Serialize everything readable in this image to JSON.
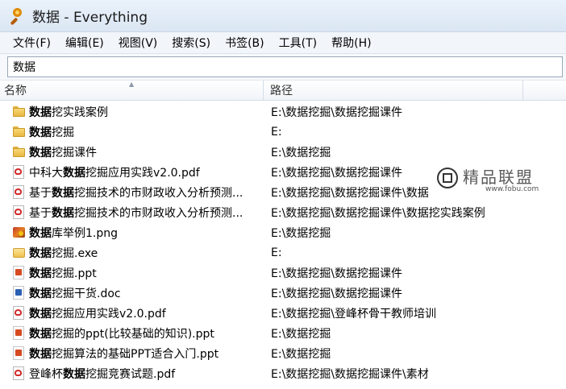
{
  "window": {
    "title": "数据 - Everything"
  },
  "menu": [
    {
      "label": "文件(F)"
    },
    {
      "label": "编辑(E)"
    },
    {
      "label": "视图(V)"
    },
    {
      "label": "搜索(S)"
    },
    {
      "label": "书签(B)"
    },
    {
      "label": "工具(T)"
    },
    {
      "label": "帮助(H)"
    }
  ],
  "search": {
    "value": "数据"
  },
  "columns": {
    "name": "名称",
    "path": "路径"
  },
  "rows": [
    {
      "pre": "",
      "hl": "数据",
      "post": "挖实践案例",
      "path": "E:\\数据挖掘\\数据挖掘课件",
      "icon": "folder-icon"
    },
    {
      "pre": "",
      "hl": "数据",
      "post": "挖掘",
      "path": "E:",
      "icon": "folder-icon"
    },
    {
      "pre": "",
      "hl": "数据",
      "post": "挖掘课件",
      "path": "E:\\数据挖掘",
      "icon": "folder-icon"
    },
    {
      "pre": "中科大",
      "hl": "数据",
      "post": "挖掘应用实践v2.0.pdf",
      "path": "E:\\数据挖掘\\数据挖掘课件",
      "icon": "pdf-icon"
    },
    {
      "pre": "基于",
      "hl": "数据",
      "post": "挖掘技术的市财政收入分析预测...",
      "path": "E:\\数据挖掘\\数据挖掘课件\\数据",
      "icon": "pdf-icon"
    },
    {
      "pre": "基于",
      "hl": "数据",
      "post": "挖掘技术的市财政收入分析预测...",
      "path": "E:\\数据挖掘\\数据挖掘课件\\数据挖实践案例",
      "icon": "pdf-icon"
    },
    {
      "pre": "",
      "hl": "数据",
      "post": "库举例1.png",
      "path": "E:\\数据挖掘",
      "icon": "image-icon"
    },
    {
      "pre": "",
      "hl": "数据",
      "post": "挖掘.exe",
      "path": "E:",
      "icon": "exe-icon"
    },
    {
      "pre": "",
      "hl": "数据",
      "post": "挖掘.ppt",
      "path": "E:\\数据挖掘\\数据挖掘课件",
      "icon": "ppt-icon"
    },
    {
      "pre": "",
      "hl": "数据",
      "post": "挖掘干货.doc",
      "path": "E:\\数据挖掘\\数据挖掘课件",
      "icon": "doc-icon"
    },
    {
      "pre": "",
      "hl": "数据",
      "post": "挖掘应用实践v2.0.pdf",
      "path": "E:\\数据挖掘\\登峰杯骨干教师培训",
      "icon": "pdf-icon"
    },
    {
      "pre": "",
      "hl": "数据",
      "post": "挖掘的ppt(比较基础的知识).ppt",
      "path": "E:\\数据挖掘",
      "icon": "ppt-icon"
    },
    {
      "pre": "",
      "hl": "数据",
      "post": "挖掘算法的基础PPT适合入门.ppt",
      "path": "E:\\数据挖掘",
      "icon": "ppt-icon"
    },
    {
      "pre": "登峰杯",
      "hl": "数据",
      "post": "挖掘竞赛试题.pdf",
      "path": "E:\\数据挖掘\\数据挖掘课件\\素材",
      "icon": "pdf-icon"
    }
  ],
  "watermark": {
    "text": "精品联盟",
    "url": "www.fobu.com"
  }
}
